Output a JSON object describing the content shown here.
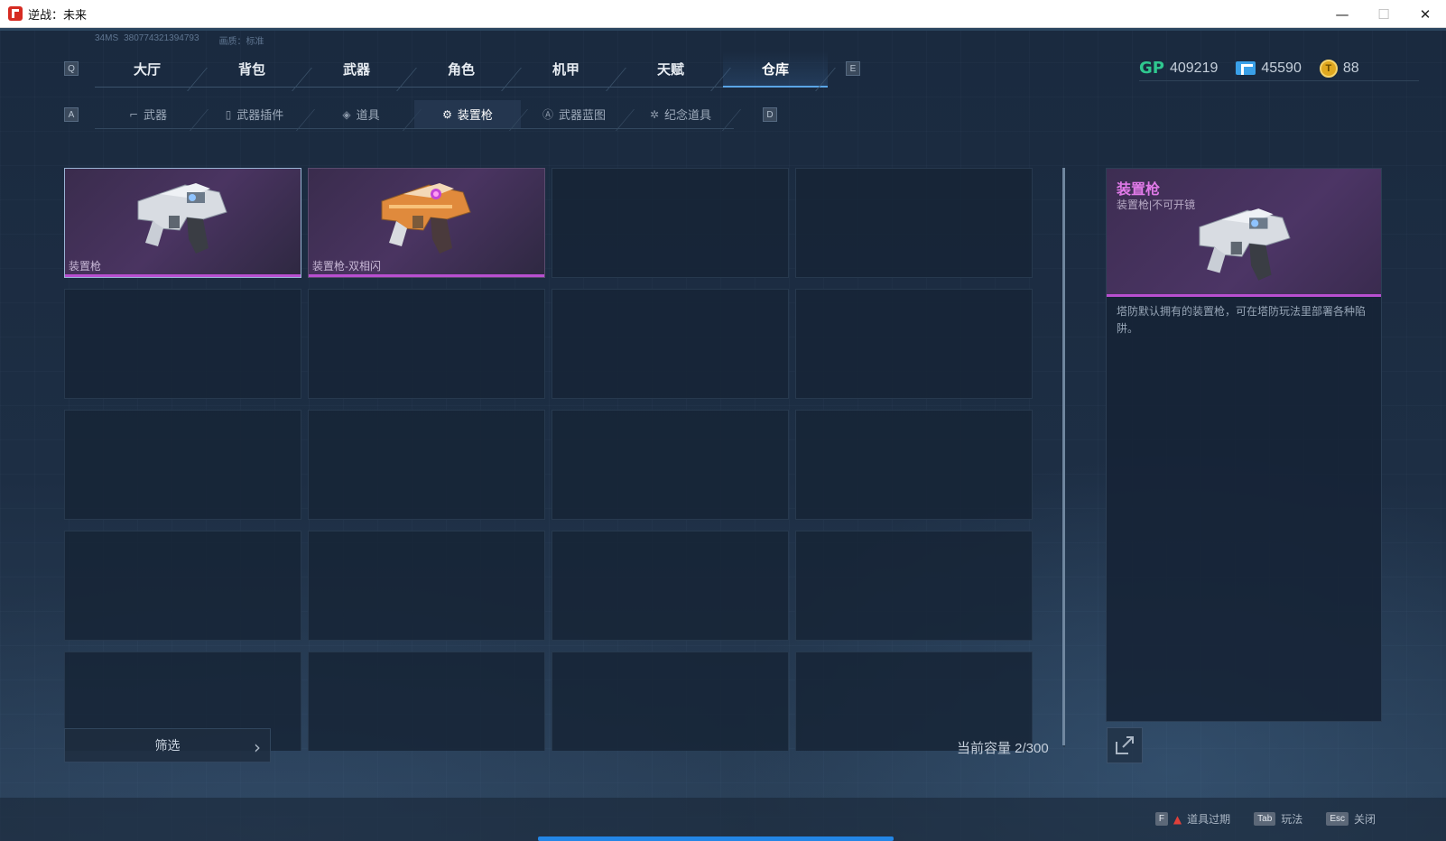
{
  "window": {
    "title": "逆战：未来",
    "minimize": "—",
    "maximize": "☐",
    "close": "✕"
  },
  "stats": {
    "ping": "34MS",
    "id": "380774321394793",
    "quality": "画质：标准"
  },
  "keys": {
    "prev_tab": "Q",
    "next_tab": "E",
    "prev_sub": "A",
    "next_sub": "D"
  },
  "main_tabs": [
    {
      "label": "大厅"
    },
    {
      "label": "背包"
    },
    {
      "label": "武器"
    },
    {
      "label": "角色"
    },
    {
      "label": "机甲"
    },
    {
      "label": "天赋"
    },
    {
      "label": "仓库"
    }
  ],
  "active_main_tab": "仓库",
  "sub_tabs": [
    {
      "label": "武器",
      "icon": "gun-icon"
    },
    {
      "label": "武器插件",
      "icon": "plugin-icon"
    },
    {
      "label": "道具",
      "icon": "item-icon"
    },
    {
      "label": "装置枪",
      "icon": "device-gun-icon"
    },
    {
      "label": "武器蓝图",
      "icon": "blueprint-icon"
    },
    {
      "label": "纪念道具",
      "icon": "medal-icon"
    }
  ],
  "active_sub_tab": "装置枪",
  "currency": {
    "gp_label": "GP",
    "gp": "409219",
    "tickets": "45590",
    "coins": "88"
  },
  "inventory": {
    "items": [
      {
        "name": "装置枪",
        "variant": "silver"
      },
      {
        "name": "装置枪-双相闪",
        "variant": "gold"
      }
    ],
    "empty_slots": 18
  },
  "filter": {
    "label": "筛选",
    "arrow": "›"
  },
  "capacity": "当前容量 2/300",
  "detail": {
    "title": "装置枪",
    "subtitle": "装置枪|不可开镜",
    "description": "塔防默认拥有的装置枪，可在塔防玩法里部署各种陷阱。"
  },
  "bottom_hints": [
    {
      "key": "F",
      "label": "道具过期",
      "warn": true
    },
    {
      "key": "Tab",
      "label": "玩法",
      "warn": false
    },
    {
      "key": "Esc",
      "label": "关闭",
      "warn": false
    }
  ],
  "colors": {
    "accent": "#5aa5e6",
    "rarity": "#b84fd0",
    "gp": "#2fc78f"
  }
}
